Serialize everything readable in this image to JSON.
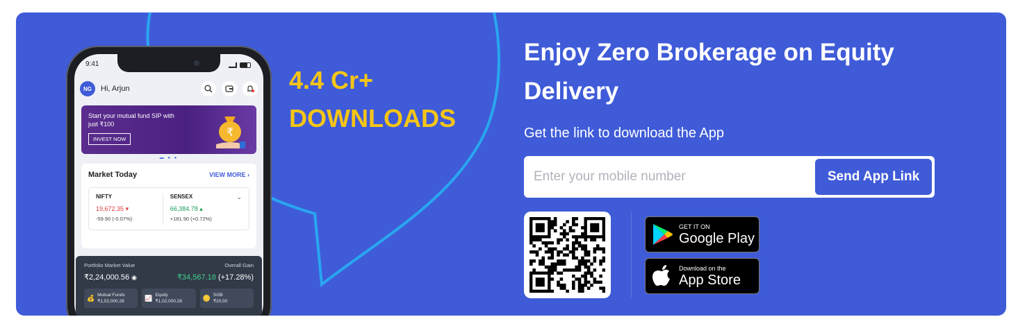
{
  "phone": {
    "time": "9:41",
    "avatar_initials": "NG",
    "greeting": "Hi, Arjun",
    "promo": {
      "text": "Start your mutual fund SIP with just ₹100",
      "button": "INVEST NOW"
    },
    "market": {
      "title": "Market Today",
      "view_more": "VIEW MORE",
      "nifty_name": "NIFTY",
      "nifty_value": "19,672.35",
      "nifty_change": "-59.90 (-0.07%)",
      "sensex_name": "SENSEX",
      "sensex_value": "66,384.78",
      "sensex_change": "+181.90 (+0.72%)"
    },
    "portfolio": {
      "label": "Portfolio Market Value",
      "gain_label": "Overall Gain",
      "value": "₹2,24,000.56",
      "gain_amount": "₹34,567.18",
      "gain_pct": "(+17.28%)",
      "chips": [
        {
          "title": "Mutual Funds",
          "value": "₹1,02,000.28"
        },
        {
          "title": "Equity",
          "value": "₹1,02,000.28"
        },
        {
          "title": "SGB",
          "value": "₹20,00"
        }
      ]
    }
  },
  "downloads": {
    "count": "4.4 Cr+",
    "label": "DOWNLOADS"
  },
  "headline": {
    "line1": "Enjoy Zero Brokerage on Equity",
    "line2": "Delivery"
  },
  "subline": "Get the link to download the App",
  "form": {
    "placeholder": "Enter your mobile number",
    "button": "Send App Link"
  },
  "stores": {
    "google_small": "GET IT ON",
    "google_big": "Google Play",
    "apple_small": "Download on the",
    "apple_big": "App Store"
  },
  "colors": {
    "banner": "#3f5bd8",
    "accent_yellow": "#f5c518",
    "button_blue": "#3f5bd8"
  }
}
